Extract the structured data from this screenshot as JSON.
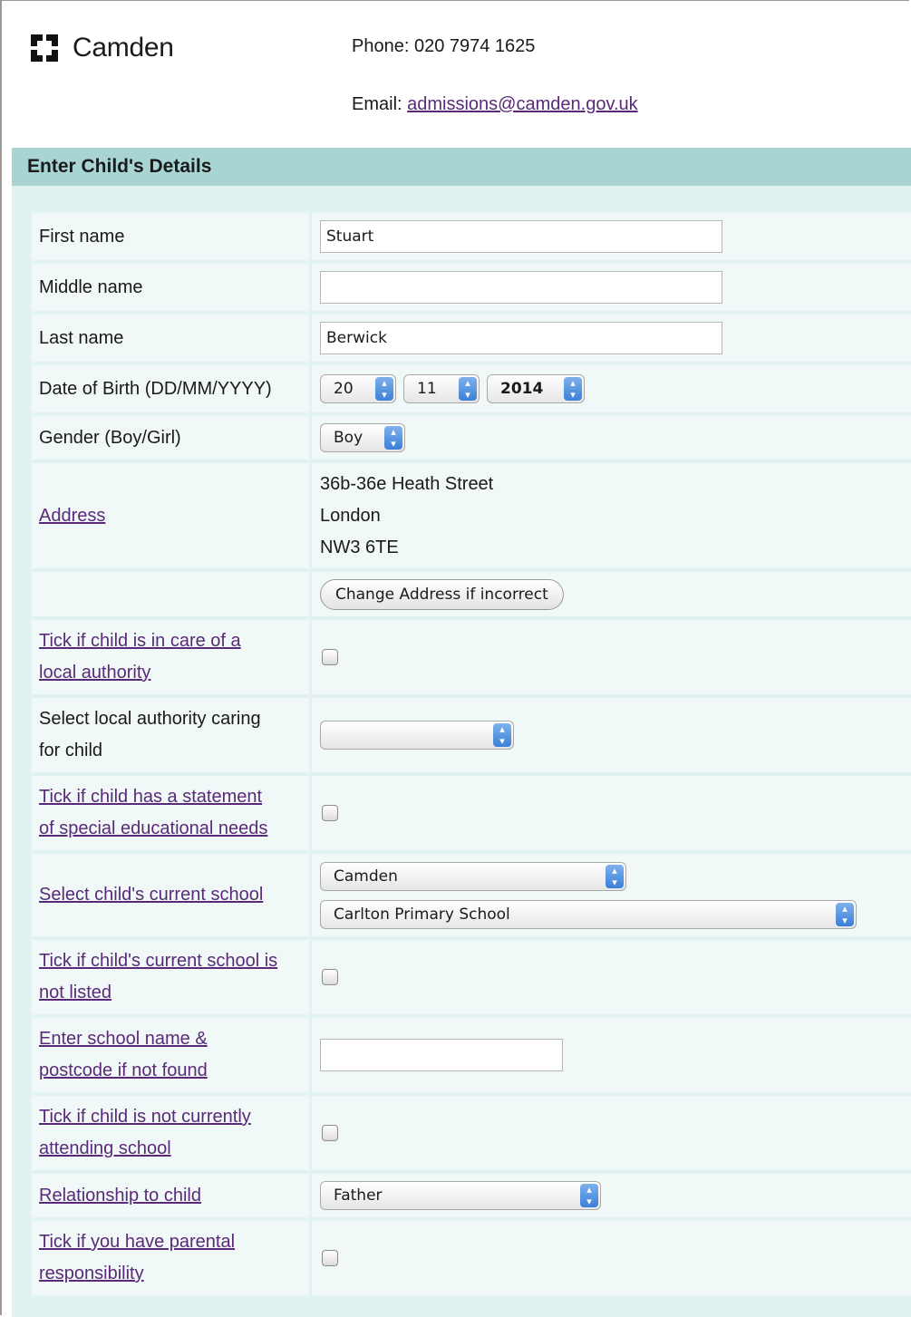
{
  "header": {
    "logo_text": "Camden",
    "phone_label": "Phone:",
    "phone_value": "020 7974 1625",
    "email_label": "Email:",
    "email_value": "admissions@camden.gov.uk"
  },
  "section": {
    "title": "Enter Child's Details"
  },
  "form": {
    "first_name": {
      "label": "First name",
      "value": "Stuart"
    },
    "middle_name": {
      "label": "Middle name",
      "value": ""
    },
    "last_name": {
      "label": "Last name",
      "value": "Berwick"
    },
    "dob": {
      "label": "Date of Birth (DD/MM/YYYY)",
      "day": "20",
      "month": "11",
      "year": "2014"
    },
    "gender": {
      "label": "Gender (Boy/Girl)",
      "value": "Boy"
    },
    "address": {
      "label": "Address",
      "lines": [
        "36b-36e Heath Street",
        "London",
        "NW3 6TE"
      ],
      "change_button": "Change Address if incorrect"
    },
    "in_care": {
      "label_line1": "Tick if child is in care of a",
      "label_line2": "local authority",
      "checked": false
    },
    "local_authority": {
      "label_line1": "Select local authority caring",
      "label_line2": "for child",
      "value": ""
    },
    "sen": {
      "label_line1": "Tick if child has a statement",
      "label_line2": "of special educational needs",
      "checked": false
    },
    "current_school": {
      "label": "Select child's current school",
      "borough": "Camden",
      "school": "Carlton Primary School"
    },
    "school_not_listed": {
      "label_line1": "Tick if child's current school is",
      "label_line2": "not listed",
      "checked": false
    },
    "school_name_entry": {
      "label_line1": "Enter school name &",
      "label_line2": "postcode if not found",
      "value": ""
    },
    "not_attending": {
      "label_line1": "Tick if child is not currently",
      "label_line2": "attending school",
      "checked": false
    },
    "relationship": {
      "label": "Relationship to child",
      "value": "Father"
    },
    "parental_responsibility": {
      "label_line1": "Tick if you have parental",
      "label_line2": "responsibility",
      "checked": false
    }
  }
}
